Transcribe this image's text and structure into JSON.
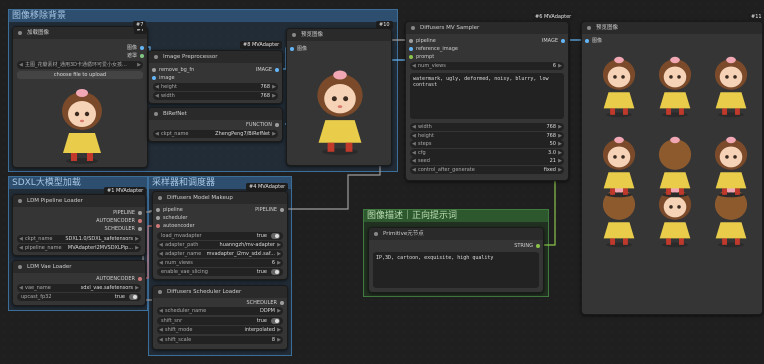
{
  "groups": {
    "g1": {
      "title": "图像移除背景"
    },
    "g2": {
      "title": "SDXL大模型加载"
    },
    "g3": {
      "title": "采样器和调度器"
    },
    "g4": {
      "title": "图像描述｜正向提示词"
    }
  },
  "badges": {
    "n7": "#7",
    "n10": "#10",
    "n8": "#8 MVAdapter",
    "n6": "#6 MVAdapter",
    "n11": "#11",
    "n1": "#1 MVAdapter",
    "n4": "#4 MVAdapter"
  },
  "load_image": {
    "title": "加载图像",
    "out_image": "图像",
    "out_mask": "遮罩",
    "file_value": "主图_花瓣素材_通用3D卡通循环可爱小女孩...",
    "upload_label": "choose file to upload"
  },
  "preprocessor": {
    "title": "Image Preprocessor",
    "in1": "remove_bg_fn",
    "in2": "image",
    "out": "IMAGE",
    "height_label": "height",
    "height_val": "768",
    "width_label": "width",
    "width_val": "768"
  },
  "birefnet": {
    "title": "BiRefNet",
    "out": "FUNCTION",
    "ckpt_label": "ckpt_name",
    "ckpt_val": "ZhengPeng7/BiRefNet"
  },
  "preview1": {
    "title": "预览图像",
    "in": "图像"
  },
  "sampler": {
    "title": "Diffusers MV Sampler",
    "in_pipeline": "pipeline",
    "in_ref": "reference_image",
    "in_prompt": "prompt",
    "out": "IMAGE",
    "num_views_label": "num_views",
    "num_views_val": "6",
    "negative": "watermark, ugly, deformed, noisy, blurry, low contrast",
    "params": [
      {
        "label": "width",
        "val": "768"
      },
      {
        "label": "height",
        "val": "768"
      },
      {
        "label": "steps",
        "val": "50"
      },
      {
        "label": "cfg",
        "val": "3.0"
      },
      {
        "label": "seed",
        "val": "21"
      },
      {
        "label": "control_after_generate",
        "val": "fixed"
      }
    ]
  },
  "preview2": {
    "title": "预览图像",
    "in": "图像"
  },
  "pipeline_loader": {
    "title": "LDM Pipeline Loader",
    "outs": [
      "PIPELINE",
      "AUTOENCODER",
      "SCHEDULER"
    ],
    "ckpt_label": "ckpt_name",
    "ckpt_val": "SDXL1.0/SDXL_safetensors",
    "pipe_label": "pipeline_name",
    "pipe_val": "MVAdapterI2MVSDXLPip..."
  },
  "vae_loader": {
    "title": "LDM Vae Loader",
    "out": "AUTOENCODER",
    "vae_label": "vae_name",
    "vae_val": "sdxl_vae.safetensors",
    "fp_label": "upcast_fp32",
    "fp_val": "true"
  },
  "makeup": {
    "title": "Diffusers Model Makeup",
    "ins": [
      "pipeline",
      "scheduler",
      "autoencoder"
    ],
    "out": "PIPELINE",
    "widgets": [
      {
        "label": "load_mvadapter",
        "val": "true"
      },
      {
        "label": "adapter_path",
        "val": "huanngzh/mv-adapter"
      },
      {
        "label": "adapter_name",
        "val": "mvadapter_i2mv_sdxl.saf..."
      },
      {
        "label": "num_views",
        "val": "6"
      },
      {
        "label": "enable_vae_slicing",
        "val": "true"
      }
    ]
  },
  "scheduler_loader": {
    "title": "Diffusers Scheduler Loader",
    "out": "SCHEDULER",
    "widgets": [
      {
        "label": "scheduler_name",
        "val": "DDPM"
      },
      {
        "label": "shift_snr",
        "val": "true"
      },
      {
        "label": "shift_mode",
        "val": "interpolated"
      },
      {
        "label": "shift_scale",
        "val": "8"
      }
    ]
  },
  "primitive": {
    "title": "Primitive元节点",
    "out": "STRING",
    "text": "IP,3D, cartoon, exquisite, high quality"
  }
}
